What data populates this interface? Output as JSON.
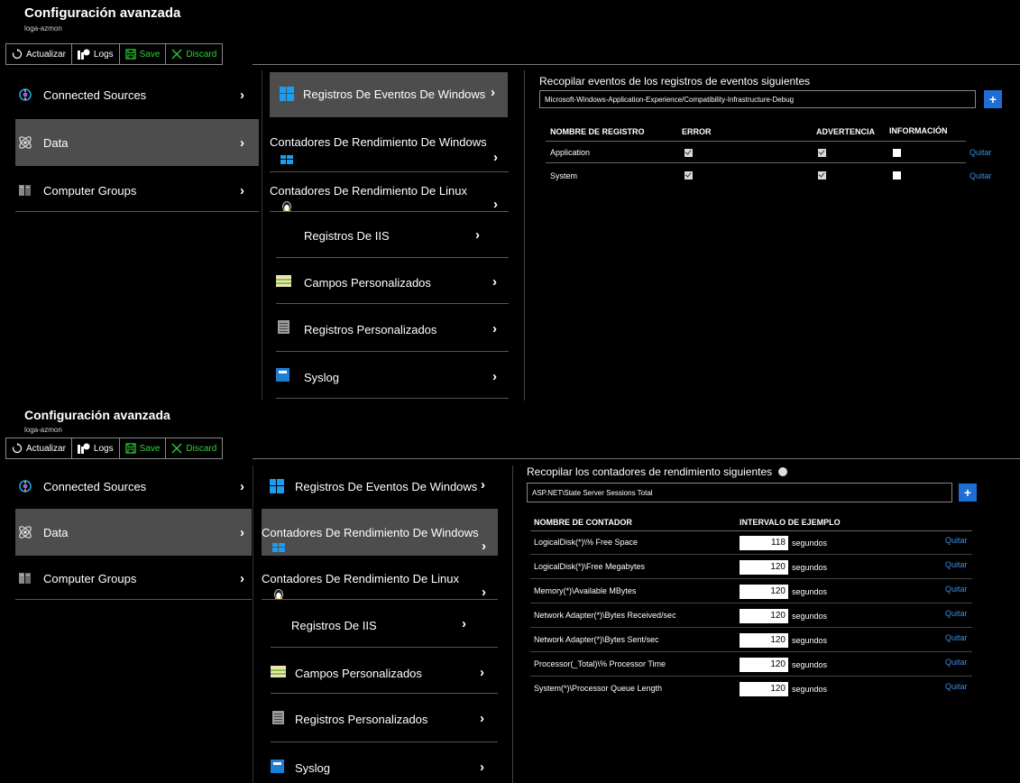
{
  "header": {
    "title": "Configuración avanzada",
    "subtitle": "loga-azmon"
  },
  "toolbar": {
    "refresh": "Actualizar",
    "logs": "Logs",
    "save": "Save",
    "discard": "Discard"
  },
  "colors": {
    "selected_bg": "#4d4d4d",
    "accent_blue": "#1f6ed4",
    "link_blue": "#3c8fe0",
    "save_green": "#2fd13b"
  },
  "sources_nav": [
    {
      "label": "Connected Sources",
      "icon": "connected-sources-icon"
    },
    {
      "label": "Data",
      "icon": "data-atom-icon",
      "selected": true
    },
    {
      "label": "Computer Groups",
      "icon": "computer-groups-icon"
    }
  ],
  "data_nav": [
    {
      "label": "Registros De Eventos De Windows",
      "icon": "windows-icon"
    },
    {
      "label": "Contadores De Rendimiento De Windows",
      "icon": "windows-icon"
    },
    {
      "label": "Contadores De Rendimiento De Linux",
      "icon": "linux-penguin-icon"
    },
    {
      "label": "Registros De IIS",
      "icon": ""
    },
    {
      "label": "Campos Personalizados",
      "icon": "custom-fields-icon"
    },
    {
      "label": "Registros Personalizados",
      "icon": "custom-logs-icon"
    },
    {
      "label": "Syslog",
      "icon": "syslog-icon"
    }
  ],
  "events_panel": {
    "title": "Recopilar eventos de los registros de eventos siguientes",
    "input_value": "Microsoft-Windows-Application-Experience/Compatibility-Infrastructure-Debug",
    "add_label": "+",
    "columns": [
      "NOMBRE DE REGISTRO",
      "ERROR",
      "ADVERTENCIA",
      "INFORMACIÓN"
    ],
    "rows": [
      {
        "name": "Application",
        "error": true,
        "warning": true,
        "information": false,
        "remove": "Quitar"
      },
      {
        "name": "System",
        "error": true,
        "warning": true,
        "information": false,
        "remove": "Quitar"
      }
    ]
  },
  "counters_panel": {
    "title": "Recopilar los contadores de rendimiento siguientes",
    "input_value": "ASP.NET\\State Server Sessions Total",
    "add_label": "+",
    "columns": [
      "NOMBRE DE CONTADOR",
      "INTERVALO DE EJEMPLO"
    ],
    "unit": "segundos",
    "rows": [
      {
        "name": "LogicalDisk(*)\\% Free Space",
        "interval": "118",
        "remove": "Quitar"
      },
      {
        "name": "LogicalDisk(*)\\Free Megabytes",
        "interval": "120",
        "remove": "Quitar"
      },
      {
        "name": "Memory(*)\\Available MBytes",
        "interval": "120",
        "remove": "Quitar"
      },
      {
        "name": "Network Adapter(*)\\Bytes Received/sec",
        "interval": "120",
        "remove": "Quitar"
      },
      {
        "name": "Network Adapter(*)\\Bytes Sent/sec",
        "interval": "120",
        "remove": "Quitar"
      },
      {
        "name": "Processor(_Total)\\% Processor Time",
        "interval": "120",
        "remove": "Quitar"
      },
      {
        "name": "System(*)\\Processor Queue Length",
        "interval": "120",
        "remove": "Quitar"
      }
    ]
  }
}
